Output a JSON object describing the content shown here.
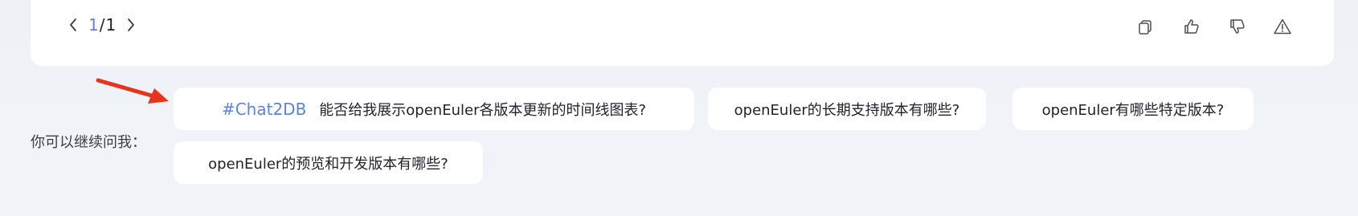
{
  "pager": {
    "current": "1",
    "separator": "/",
    "total": "1"
  },
  "actions": [
    {
      "name": "copy-icon"
    },
    {
      "name": "thumbs-up-icon"
    },
    {
      "name": "thumbs-down-icon"
    },
    {
      "name": "warning-icon"
    }
  ],
  "suggestions": {
    "label": "你可以继续问我：",
    "items": [
      {
        "tag": "#Chat2DB",
        "text": "能否给我展示openEuler各版本更新的时间线图表?"
      },
      {
        "text": "openEuler的长期支持版本有哪些?"
      },
      {
        "text": "openEuler有哪些特定版本?"
      },
      {
        "text": "openEuler的预览和开发版本有哪些?"
      }
    ]
  },
  "colors": {
    "accent": "#5b83e6",
    "arrow": "#e8341c",
    "card": "#ffffff",
    "background": "#eef2f7"
  }
}
